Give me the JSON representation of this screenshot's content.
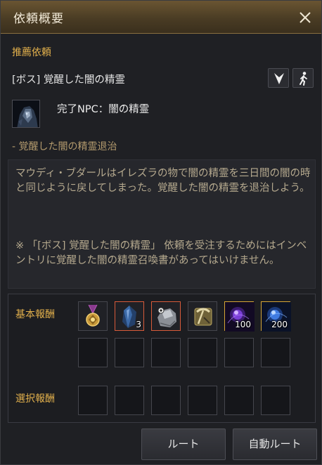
{
  "window": {
    "title": "依頼概要"
  },
  "quest": {
    "category": "推薦依頼",
    "name": "[ボス] 覚醒した闇の精霊",
    "npc_label": "完了NPC：闇の精霊",
    "objective": "- 覚醒した闇の精霊退治",
    "description": "マウディ・ブダールはイレズラの物で闇の精霊を三日間の闇の時と同じように戻してしまった。覚醒した闇の精霊を退治しよう。",
    "note": "※ 「[ボス] 覚醒した闇の精霊」 依頼を受注するためにはインベントリに覚醒した闇の精霊召喚書があってはいけません。"
  },
  "rewards": {
    "basic_label": "基本報酬",
    "select_label": "選択報酬",
    "basic_items": [
      {
        "icon": "medal-icon",
        "count": ""
      },
      {
        "icon": "blue-crystal-icon",
        "count": "3"
      },
      {
        "icon": "stone-icon",
        "count": ""
      },
      {
        "icon": "pickaxe-icon",
        "count": ""
      },
      {
        "icon": "purple-orb-icon",
        "count": "100"
      },
      {
        "icon": "blue-orb-icon",
        "count": "200"
      }
    ]
  },
  "buttons": {
    "route": "ルート",
    "auto_route": "自動ルート"
  },
  "colors": {
    "accent": "#e2b04c",
    "objective": "#b39a6d",
    "rare_border": "#d85b3a",
    "epic_border": "#d6a535"
  }
}
